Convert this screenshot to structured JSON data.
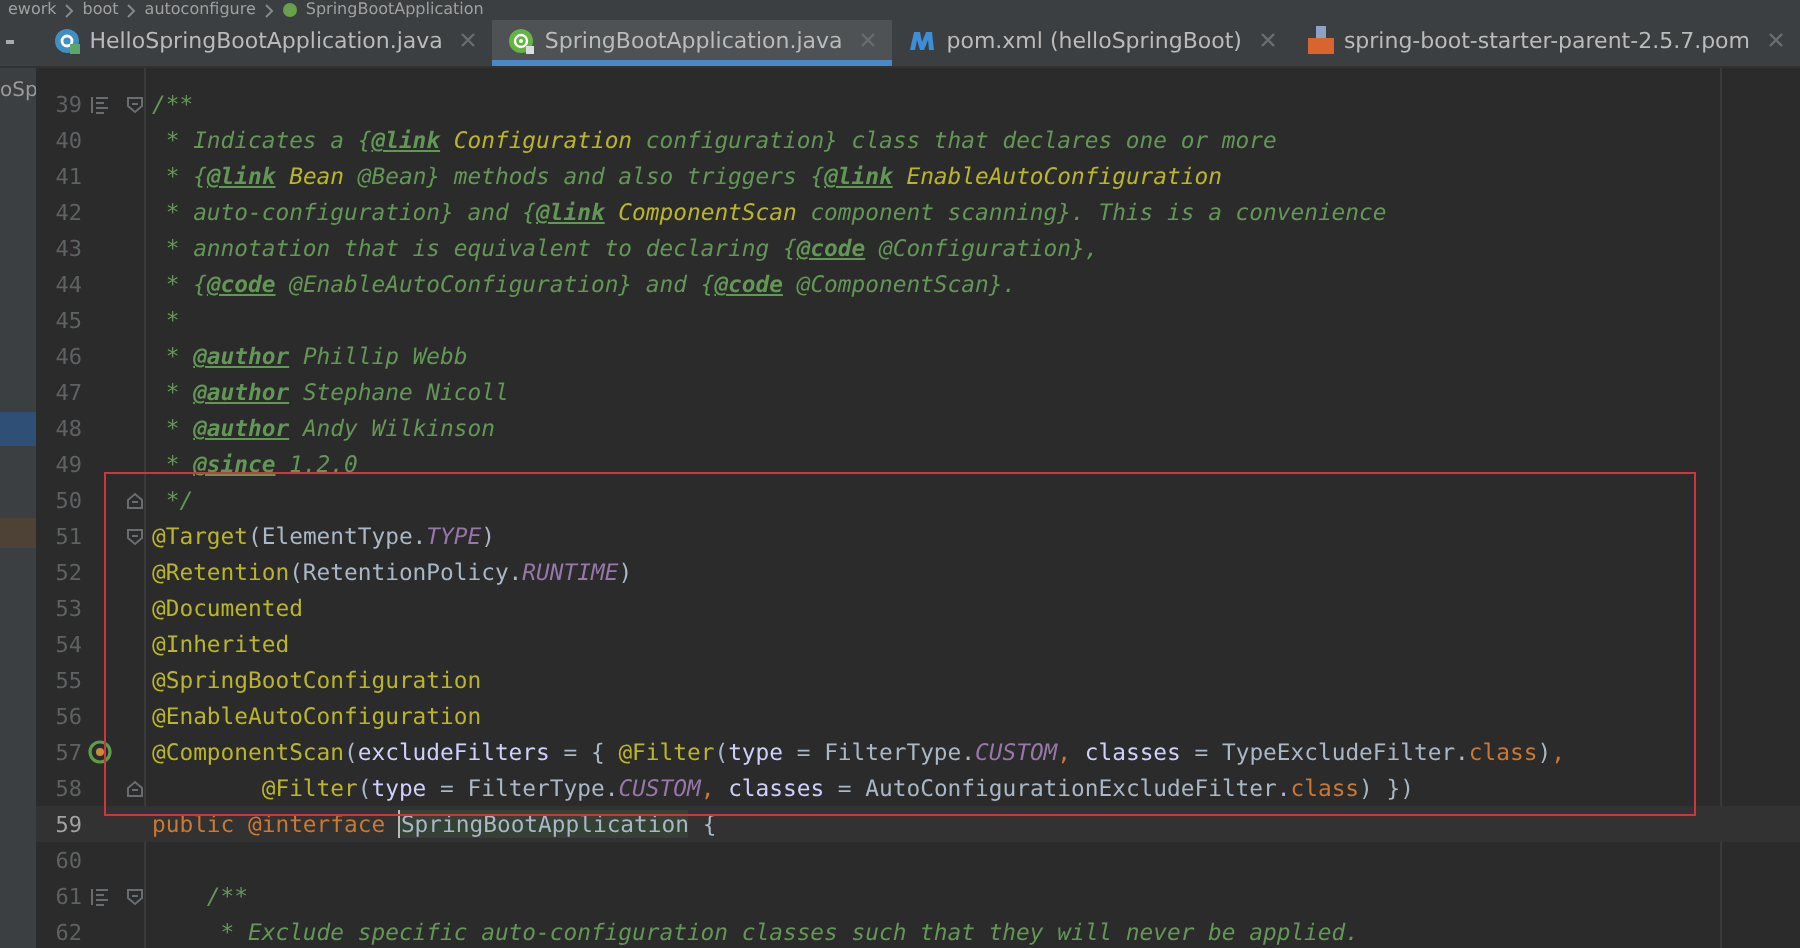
{
  "breadcrumb": [
    {
      "label": "ework"
    },
    {
      "label": "boot"
    },
    {
      "label": "autoconfigure"
    },
    {
      "label": "SpringBootApplication",
      "kind": "spring"
    }
  ],
  "tabs": [
    {
      "label": "HelloSpringBootApplication.java",
      "kind": "java-class",
      "selected": false
    },
    {
      "label": "SpringBootApplication.java",
      "kind": "spring-annotation",
      "selected": true
    },
    {
      "label": "pom.xml (helloSpringBoot)",
      "kind": "maven",
      "selected": false
    },
    {
      "label": "spring-boot-starter-parent-2.5.7.pom",
      "kind": "pom",
      "selected": false
    }
  ],
  "sidebar": {
    "fragment": "oSp"
  },
  "editor": {
    "lines": [
      {
        "number": "39",
        "doc_toggle": true,
        "fold_start": true,
        "boxed": false,
        "current": false,
        "tokens": [
          {
            "kind": "comment",
            "text": "/**"
          }
        ]
      },
      {
        "number": "40",
        "boxed": false,
        "current": false,
        "tokens": [
          {
            "kind": "comment",
            "text": " * Indicates a {"
          },
          {
            "kind": "doctag",
            "text": "@link"
          },
          {
            "kind": "docref",
            "text": " Configuration"
          },
          {
            "kind": "comment",
            "text": " configuration} class that declares one or more"
          }
        ]
      },
      {
        "number": "41",
        "boxed": false,
        "current": false,
        "tokens": [
          {
            "kind": "comment",
            "text": " * {"
          },
          {
            "kind": "doctag",
            "text": "@link"
          },
          {
            "kind": "docref",
            "text": " Bean"
          },
          {
            "kind": "comment",
            "text": " @Bean} methods and also triggers {"
          },
          {
            "kind": "doctag",
            "text": "@link"
          },
          {
            "kind": "docref",
            "text": " EnableAutoConfiguration"
          }
        ]
      },
      {
        "number": "42",
        "boxed": false,
        "current": false,
        "tokens": [
          {
            "kind": "comment",
            "text": " * auto-configuration} and {"
          },
          {
            "kind": "doctag",
            "text": "@link"
          },
          {
            "kind": "docref",
            "text": " ComponentScan"
          },
          {
            "kind": "comment",
            "text": " component scanning}. This is a convenience"
          }
        ]
      },
      {
        "number": "43",
        "boxed": false,
        "current": false,
        "tokens": [
          {
            "kind": "comment",
            "text": " * annotation that is equivalent to declaring {"
          },
          {
            "kind": "doctag",
            "text": "@code"
          },
          {
            "kind": "comment",
            "text": " @Configuration},"
          }
        ]
      },
      {
        "number": "44",
        "boxed": false,
        "current": false,
        "tokens": [
          {
            "kind": "comment",
            "text": " * {"
          },
          {
            "kind": "doctag",
            "text": "@code"
          },
          {
            "kind": "comment",
            "text": " @EnableAutoConfiguration} and {"
          },
          {
            "kind": "doctag",
            "text": "@code"
          },
          {
            "kind": "comment",
            "text": " @ComponentScan}."
          }
        ]
      },
      {
        "number": "45",
        "boxed": false,
        "current": false,
        "tokens": [
          {
            "kind": "comment",
            "text": " *"
          }
        ]
      },
      {
        "number": "46",
        "boxed": false,
        "current": false,
        "tokens": [
          {
            "kind": "comment",
            "text": " * "
          },
          {
            "kind": "doctag",
            "text": "@author"
          },
          {
            "kind": "comment",
            "text": " Phillip Webb"
          }
        ]
      },
      {
        "number": "47",
        "boxed": false,
        "current": false,
        "tokens": [
          {
            "kind": "comment",
            "text": " * "
          },
          {
            "kind": "doctag",
            "text": "@author"
          },
          {
            "kind": "comment",
            "text": " Stephane Nicoll"
          }
        ]
      },
      {
        "number": "48",
        "boxed": false,
        "current": false,
        "tokens": [
          {
            "kind": "comment",
            "text": " * "
          },
          {
            "kind": "doctag",
            "text": "@author"
          },
          {
            "kind": "comment",
            "text": " Andy Wilkinson"
          }
        ]
      },
      {
        "number": "49",
        "boxed": false,
        "current": false,
        "tokens": [
          {
            "kind": "comment",
            "text": " * "
          },
          {
            "kind": "doctag",
            "text": "@since"
          },
          {
            "kind": "comment",
            "text": " 1.2.0"
          }
        ]
      },
      {
        "number": "50",
        "fold_end": true,
        "boxed": true,
        "current": false,
        "tokens": [
          {
            "kind": "comment",
            "text": " */"
          }
        ]
      },
      {
        "number": "51",
        "fold_start": true,
        "boxed": true,
        "current": false,
        "tokens": [
          {
            "kind": "annotation",
            "text": "@Target"
          },
          {
            "kind": "plain",
            "text": "(ElementType."
          },
          {
            "kind": "constant",
            "text": "TYPE"
          },
          {
            "kind": "plain",
            "text": ")"
          }
        ]
      },
      {
        "number": "52",
        "boxed": true,
        "current": false,
        "tokens": [
          {
            "kind": "annotation",
            "text": "@Retention"
          },
          {
            "kind": "plain",
            "text": "(RetentionPolicy."
          },
          {
            "kind": "constant",
            "text": "RUNTIME"
          },
          {
            "kind": "plain",
            "text": ")"
          }
        ]
      },
      {
        "number": "53",
        "boxed": true,
        "current": false,
        "tokens": [
          {
            "kind": "annotation",
            "text": "@Documented"
          }
        ]
      },
      {
        "number": "54",
        "boxed": true,
        "current": false,
        "tokens": [
          {
            "kind": "annotation",
            "text": "@Inherited"
          }
        ]
      },
      {
        "number": "55",
        "boxed": true,
        "current": false,
        "tokens": [
          {
            "kind": "annotation",
            "text": "@SpringBootConfiguration"
          }
        ]
      },
      {
        "number": "56",
        "boxed": true,
        "current": false,
        "tokens": [
          {
            "kind": "annotation",
            "text": "@EnableAutoConfiguration"
          }
        ]
      },
      {
        "number": "57",
        "bean_gutter": true,
        "boxed": true,
        "current": false,
        "tokens": [
          {
            "kind": "annotation",
            "text": "@ComponentScan"
          },
          {
            "kind": "plain",
            "text": "("
          },
          {
            "kind": "param",
            "text": "excludeFilters"
          },
          {
            "kind": "plain",
            "text": " = { "
          },
          {
            "kind": "annotation",
            "text": "@Filter"
          },
          {
            "kind": "plain",
            "text": "("
          },
          {
            "kind": "param",
            "text": "type"
          },
          {
            "kind": "plain",
            "text": " = FilterType."
          },
          {
            "kind": "constant",
            "text": "CUSTOM"
          },
          {
            "kind": "keyword",
            "text": ", "
          },
          {
            "kind": "param",
            "text": "classes"
          },
          {
            "kind": "plain",
            "text": " = TypeExcludeFilter."
          },
          {
            "kind": "keyword",
            "text": "class"
          },
          {
            "kind": "plain",
            "text": ")"
          },
          {
            "kind": "keyword",
            "text": ","
          }
        ]
      },
      {
        "number": "58",
        "fold_end": true,
        "boxed": true,
        "current": false,
        "tokens": [
          {
            "kind": "annotation",
            "text": "        @Filter"
          },
          {
            "kind": "plain",
            "text": "("
          },
          {
            "kind": "param",
            "text": "type"
          },
          {
            "kind": "plain",
            "text": " = FilterType."
          },
          {
            "kind": "constant",
            "text": "CUSTOM"
          },
          {
            "kind": "keyword",
            "text": ", "
          },
          {
            "kind": "param",
            "text": "classes"
          },
          {
            "kind": "plain",
            "text": " = AutoConfigurationExcludeFilter."
          },
          {
            "kind": "keyword",
            "text": "class"
          },
          {
            "kind": "plain",
            "text": ") })"
          }
        ]
      },
      {
        "number": "59",
        "boxed": false,
        "current": true,
        "tokens": [
          {
            "kind": "keyword",
            "text": "public @interface "
          },
          {
            "kind": "usage",
            "text": "SpringBootApplication"
          },
          {
            "kind": "plain",
            "text": " {"
          }
        ]
      },
      {
        "number": "60",
        "boxed": false,
        "current": false
      },
      {
        "number": "61",
        "doc_toggle": true,
        "fold_start": true,
        "boxed": false,
        "current": false,
        "tokens": [
          {
            "kind": "comment",
            "text": "    /**"
          }
        ]
      },
      {
        "number": "62",
        "boxed": false,
        "current": false,
        "tokens": [
          {
            "kind": "comment",
            "text": "     * Exclude specific auto-configuration classes such that they will never be applied."
          }
        ]
      }
    ]
  }
}
